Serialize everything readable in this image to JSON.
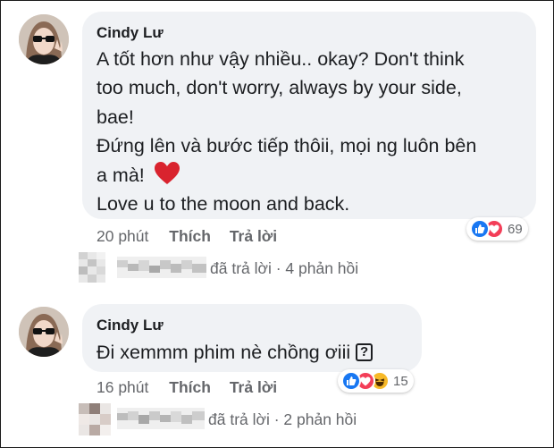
{
  "comments": [
    {
      "author": "Cindy Lư",
      "lines": [
        "A tốt hơn như vậy nhiều.. okay? Don't think",
        "too much, don't worry, always by your side,",
        "bae!",
        "Đứng lên và bước tiếp thôii, mọi ng luôn bên",
        "a mà!",
        "Love u to the moon and back."
      ],
      "emoji_after_line5": "heart",
      "time": "20 phút",
      "like_label": "Thích",
      "reply_label": "Trả lời",
      "reactions": [
        "like-icon",
        "love-icon"
      ],
      "reaction_count": "69",
      "replies_text": "đã trả lời · 4 phản hồi"
    },
    {
      "author": "Cindy Lư",
      "lines": [
        "Đi xemmm phim nè chồng ơiii"
      ],
      "unknown_glyph": "?",
      "time": "16 phút",
      "like_label": "Thích",
      "reply_label": "Trả lời",
      "reactions": [
        "like-icon",
        "love-icon",
        "haha-icon"
      ],
      "reaction_count": "15",
      "replies_text": "đã trả lời · 2 phản hồi"
    }
  ],
  "colors": {
    "bubble": "#f0f2f5",
    "meta_text": "#65676b",
    "like_blue": "#1877f2",
    "love_red": "#f33e58",
    "haha_yellow": "#f7b928"
  }
}
